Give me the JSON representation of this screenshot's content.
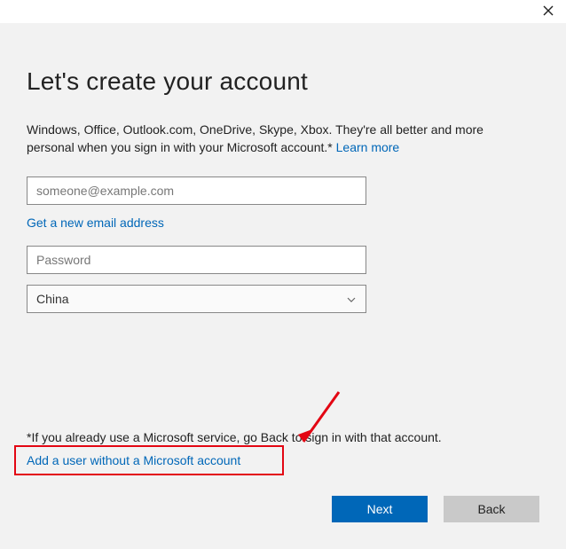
{
  "header": {
    "title": "Let's create your account"
  },
  "intro": {
    "text": "Windows, Office, Outlook.com, OneDrive, Skype, Xbox. They're all better and more personal when you sign in with your Microsoft account.* ",
    "learn_more": "Learn more"
  },
  "form": {
    "email_placeholder": "someone@example.com",
    "email_value": "",
    "get_new_email": "Get a new email address",
    "password_placeholder": "Password",
    "password_value": "",
    "country_selected": "China"
  },
  "footer": {
    "note": "*If you already use a Microsoft service, go Back to sign in with that account.",
    "add_user_link": "Add a user without a Microsoft account"
  },
  "buttons": {
    "next": "Next",
    "back": "Back"
  }
}
